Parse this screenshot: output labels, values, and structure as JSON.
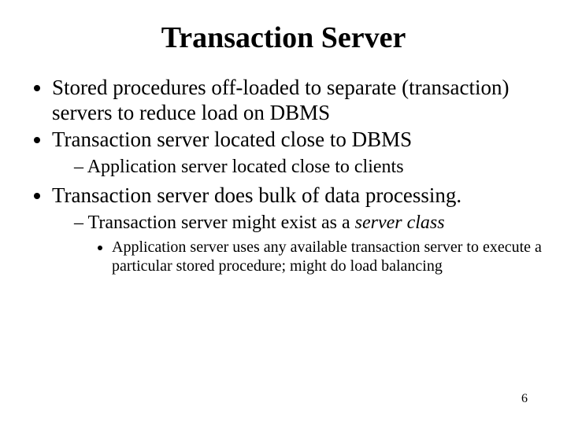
{
  "title": "Transaction Server",
  "b1": "Stored procedures off-loaded to separate (transaction) servers to reduce load on DBMS",
  "b2": "Transaction server located close to DBMS",
  "b2s1": "Application server located close to clients",
  "b3": "Transaction server does bulk of data processing.",
  "b3s1a": "Transaction server might exist as a ",
  "b3s1b": "server class",
  "b3s1s1": "Application server uses any available transaction server to execute a particular stored procedure; might do load balancing",
  "pagenum": "6"
}
